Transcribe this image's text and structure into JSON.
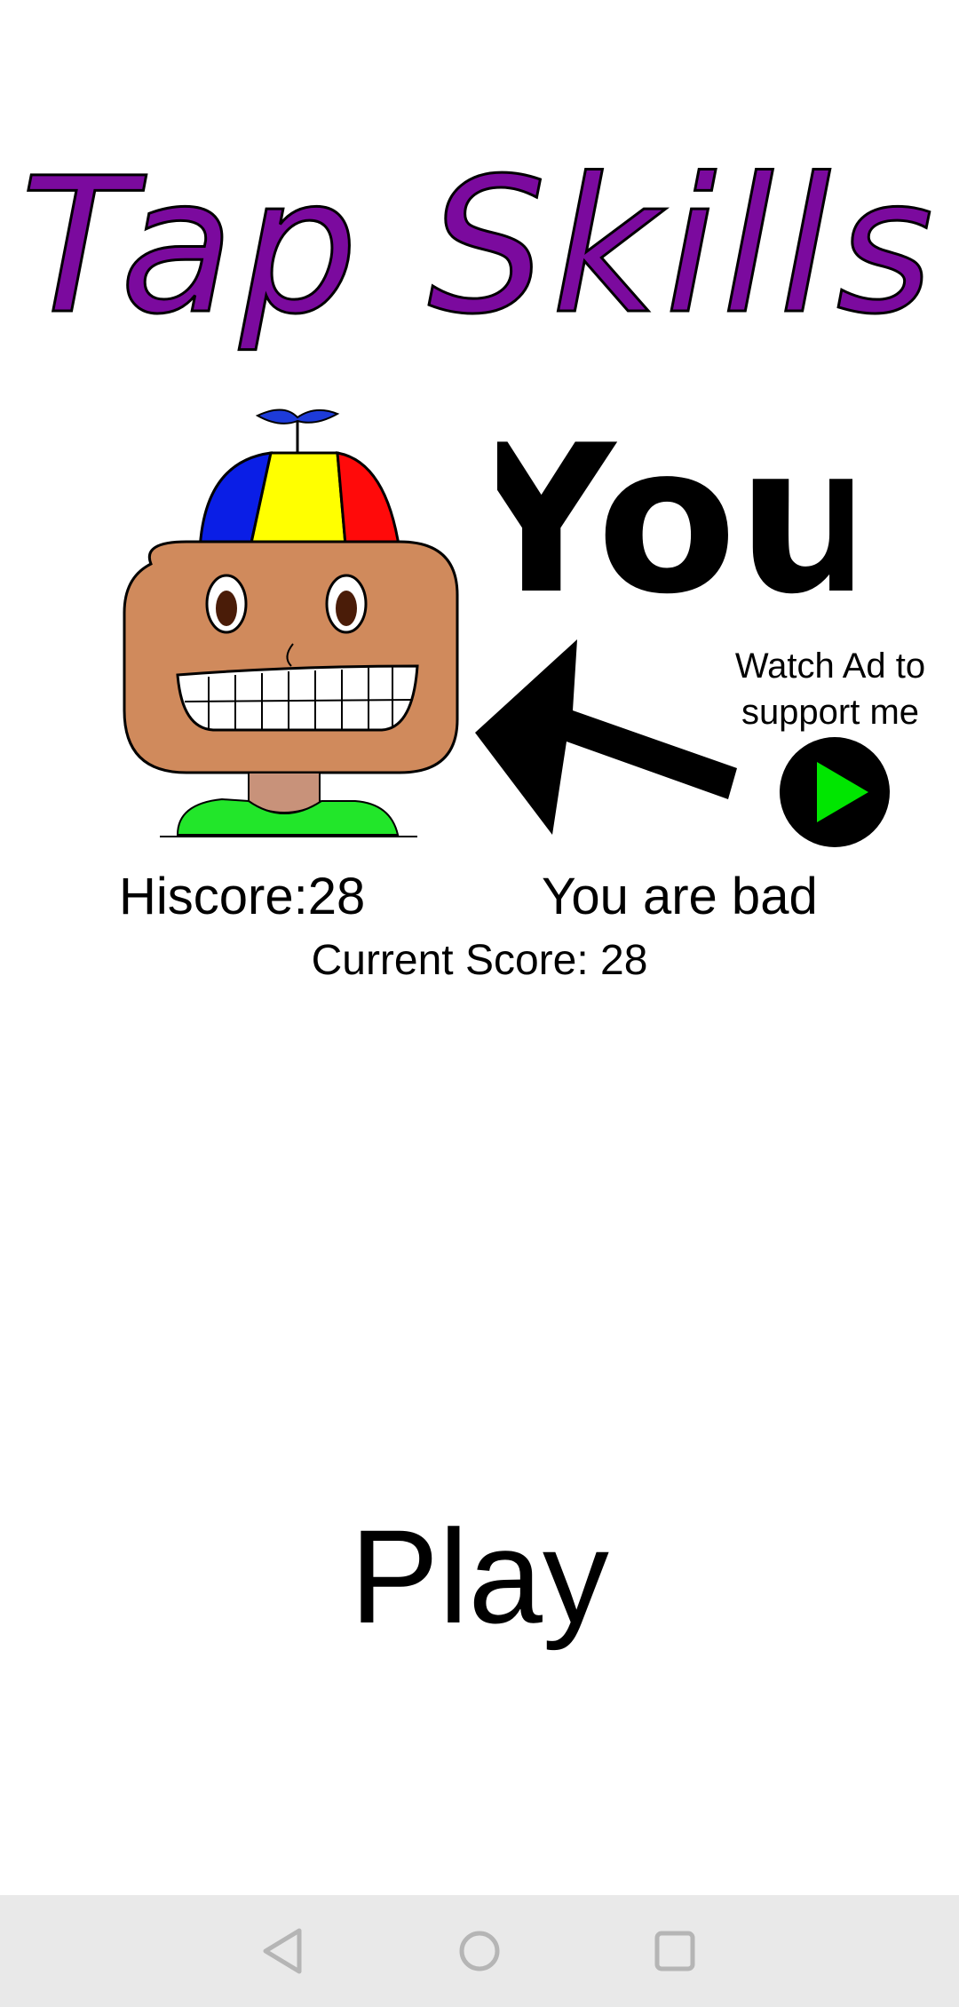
{
  "game": {
    "title": "Tap Skills",
    "you_label": "You",
    "ad_label": "Watch Ad to\nsupport me",
    "hiscore_text": "Hiscore:28",
    "status_text": "You are bad",
    "current_score_text": "Current Score: 28",
    "play_label": "Play"
  },
  "icons": {
    "ad_play": "play-triangle-icon",
    "arrow": "arrow-left-up-icon",
    "character": "propeller-hat-character",
    "nav_back": "back-triangle-icon",
    "nav_home": "home-circle-icon",
    "nav_recents": "recents-square-icon"
  },
  "colors": {
    "title": "#7b0a9e",
    "background": "#ffffff",
    "ad_button_ring": "#000000",
    "ad_button_play": "#00e600",
    "nav_background": "#e9e9e9"
  }
}
